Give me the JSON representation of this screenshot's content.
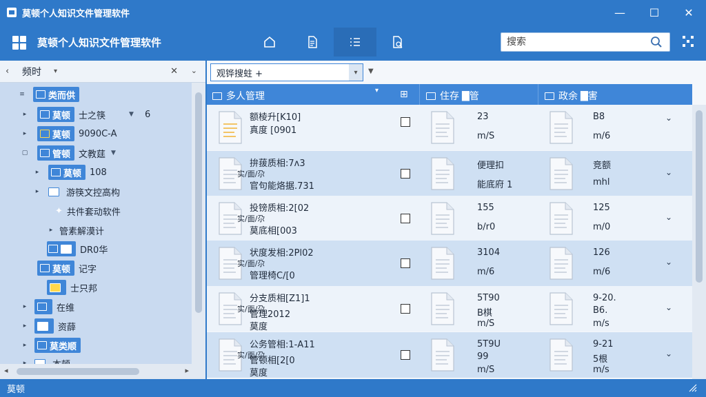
{
  "window": {
    "title": "莫顿个人知识文件管理软件",
    "minimize": "—",
    "maximize": "☐",
    "close": "✕"
  },
  "header": {
    "app_name": "莫顿个人知识文件管理软件",
    "toolbar": [
      {
        "icon": "home-icon",
        "active": false
      },
      {
        "icon": "document-icon",
        "active": false
      },
      {
        "icon": "list-icon",
        "active": true
      },
      {
        "icon": "file-search-icon",
        "active": false
      }
    ],
    "search": {
      "placeholder": "搜索",
      "value": ""
    }
  },
  "left_pane": {
    "head": {
      "back": "‹",
      "label": "频时",
      "close": "✕",
      "collapse": "⌄"
    },
    "tree": [
      {
        "tag": "类而供",
        "text": "",
        "count": "",
        "expander": "≡"
      },
      {
        "tag": "莫顿",
        "text": "士之筷",
        "count": "6",
        "expander": "▸"
      },
      {
        "tag": "莫顿",
        "text": "9090C-A",
        "count": "",
        "expander": "▸"
      },
      {
        "tag": "管顿",
        "text": "文教莛",
        "count": "",
        "expander": "▢"
      },
      {
        "tag": "莫顿",
        "text": "108",
        "count": "",
        "expander": "▸"
      },
      {
        "tag": "",
        "text": "游筷文控高构",
        "count": "",
        "expander": "▸"
      },
      {
        "tag": "",
        "text": "共件套动软件",
        "count": "",
        "expander": ""
      },
      {
        "tag": "",
        "text": "管素解漠计",
        "count": "",
        "expander": "▸"
      },
      {
        "tag": "",
        "text": "DR0华",
        "count": "",
        "expander": ""
      },
      {
        "tag": "莫顿",
        "text": "记字",
        "count": "",
        "expander": ""
      },
      {
        "tag": "",
        "text": "士只邦",
        "count": "",
        "expander": ""
      },
      {
        "tag": "",
        "text": "在维",
        "count": "",
        "expander": "▸"
      },
      {
        "tag": "",
        "text": "资薛",
        "count": "",
        "expander": "▸"
      },
      {
        "tag": "莫类顺",
        "text": "",
        "count": "",
        "expander": "▸"
      },
      {
        "tag": "",
        "text": "本顿",
        "count": "",
        "expander": "▸"
      }
    ]
  },
  "right_pane": {
    "filter": {
      "value": "观铧搜蛀 +",
      "dropdown": "▾"
    },
    "columns": [
      "多人管理",
      "住存",
      "管",
      "政余",
      "害"
    ],
    "rows": [
      {
        "title": "额棱升[K10]",
        "sub": "",
        "line2": "真度 [0901",
        "c2a": "23",
        "c2b": "m/S",
        "c3a": "B8",
        "c3b": "m/6"
      },
      {
        "title": "拚菝质相:7ʌ3",
        "sub": "实/面/尕",
        "line2": "官句能烙据.731",
        "c2a": "便理扣",
        "c2b": "能底府 1",
        "c3a": "竞额",
        "c3b": "mhl"
      },
      {
        "title": "投镑质相:2[02",
        "sub": "实/面/尕",
        "line2": "莫底相[003",
        "c2a": "155",
        "c2b": "b/r0",
        "c3a": "125",
        "c3b": "m/0"
      },
      {
        "title": "状度发相:2Pl02",
        "sub": "实/面/尕",
        "line2": "管理椅C/[0",
        "c2a": "3104",
        "c2b": "m/6",
        "c3a": "126",
        "c3b": "m/6"
      },
      {
        "title": "分支质相[Z1]1",
        "sub": "实/面/尕",
        "line2": "管理2012",
        "line3": "莫度",
        "c2a": "5T90",
        "c2b": "B棋",
        "c2c": "m/S",
        "c3a": "9-20.",
        "c3b": "B6.",
        "c3c": "m/s"
      },
      {
        "title": "公务管相:1-A11",
        "sub": "实/面/尕",
        "line2": "管顿相[2[0",
        "line3": "莫度",
        "c2a": "5T9U",
        "c2b": "99",
        "c2c": "m/S",
        "c3a": "9-21",
        "c3b": "5根",
        "c3c": "m/s"
      }
    ]
  },
  "status": {
    "text": "莫顿"
  },
  "colors": {
    "primary": "#2f79c9",
    "accent": "#3f86d8",
    "row_alt": "#cfe0f3",
    "tree_bg": "#c9daf0"
  }
}
